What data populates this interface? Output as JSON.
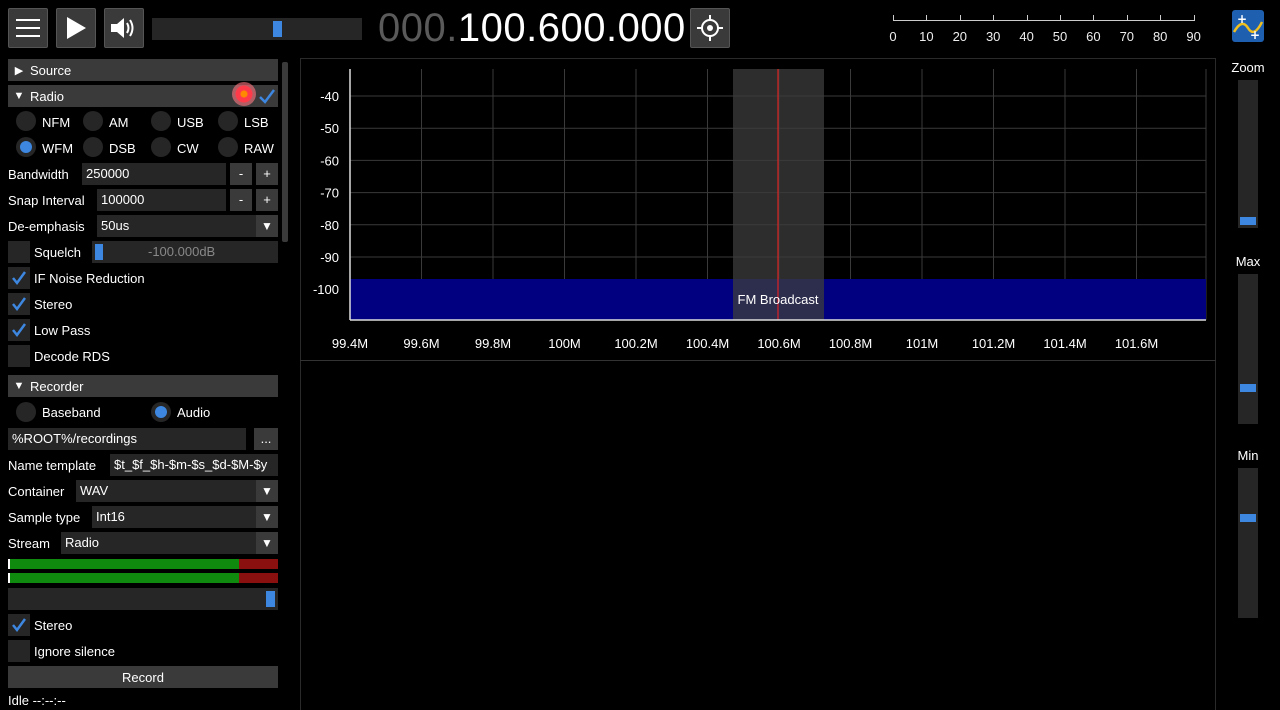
{
  "topbar": {
    "menu_icon": "hamburger-icon",
    "play_icon": "play-icon",
    "volume_icon": "speaker-icon",
    "volume_level": 0.6,
    "frequency_dim": "000.",
    "frequency_bright": "100.600.000",
    "center_icon": "crosshair-icon",
    "snr_labels": [
      "0",
      "10",
      "20",
      "30",
      "40",
      "50",
      "60",
      "70",
      "80",
      "90"
    ]
  },
  "menu": {
    "source": {
      "label": "Source"
    },
    "radio": {
      "label": "Radio",
      "demods": [
        "NFM",
        "AM",
        "USB",
        "LSB",
        "WFM",
        "DSB",
        "CW",
        "RAW"
      ],
      "selected_demod": "WFM",
      "bandwidth_label": "Bandwidth",
      "bandwidth_value": "250000",
      "snap_label": "Snap Interval",
      "snap_value": "100000",
      "deemph_label": "De-emphasis",
      "deemph_value": "50us",
      "squelch_label": "Squelch",
      "squelch_value": "-100.000dB",
      "squelch_checked": false,
      "if_nr_label": "IF Noise Reduction",
      "if_nr_checked": true,
      "stereo_label": "Stereo",
      "stereo_checked": true,
      "lowpass_label": "Low Pass",
      "lowpass_checked": true,
      "rds_label": "Decode RDS",
      "rds_checked": false,
      "minus": "-",
      "plus": "+"
    },
    "recorder": {
      "label": "Recorder",
      "mode_baseband": "Baseband",
      "mode_audio": "Audio",
      "selected_mode": "Audio",
      "path_value": "%ROOT%/recordings",
      "browse": "...",
      "name_template_label": "Name template",
      "name_template_value": "$t_$f_$h-$m-$s_$d-$M-$y",
      "container_label": "Container",
      "container_value": "WAV",
      "sample_type_label": "Sample type",
      "sample_type_value": "Int16",
      "stream_label": "Stream",
      "stream_value": "Radio",
      "stereo_label": "Stereo",
      "stereo_checked": true,
      "ignore_silence_label": "Ignore silence",
      "ignore_silence_checked": false,
      "record_button": "Record",
      "status": "Idle --:--:--"
    }
  },
  "spectrum": {
    "y_labels": [
      "-40",
      "-50",
      "-60",
      "-70",
      "-80",
      "-90",
      "-100"
    ],
    "x_labels": [
      "99.4M",
      "99.6M",
      "99.8M",
      "100M",
      "100.2M",
      "100.4M",
      "100.6M",
      "100.8M",
      "101M",
      "101.2M",
      "101.4M",
      "101.6M"
    ],
    "band_label": "FM Broadcast",
    "colors": {
      "band": "#000080",
      "vfo": "#3c3c3c",
      "center_line": "#ff2020",
      "grid": "#3a3a3a"
    }
  },
  "right_panel": {
    "zoom_label": "Zoom",
    "max_label": "Max",
    "min_label": "Min"
  },
  "colors": {
    "accent": "#3d87e0",
    "panel": "#3a3a3a",
    "field": "#262626"
  }
}
